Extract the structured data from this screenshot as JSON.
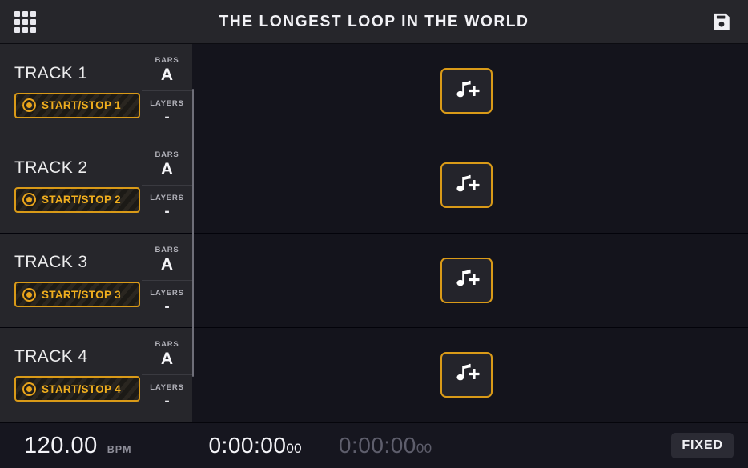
{
  "header": {
    "menu_icon": "grid-apps-icon",
    "title": "THE LONGEST LOOP IN THE WORLD",
    "save_icon": "floppy-save-icon"
  },
  "tracks": [
    {
      "name": "TRACK 1",
      "start_stop_label": "START/STOP 1",
      "record_icon": "record-target-icon",
      "bars_label": "BARS",
      "bars_value": "A",
      "layers_label": "LAYERS",
      "layers_value": "-",
      "add_clip_icon": "music-note-plus-icon"
    },
    {
      "name": "TRACK 2",
      "start_stop_label": "START/STOP 2",
      "record_icon": "record-target-icon",
      "bars_label": "BARS",
      "bars_value": "A",
      "layers_label": "LAYERS",
      "layers_value": "-",
      "add_clip_icon": "music-note-plus-icon"
    },
    {
      "name": "TRACK 3",
      "start_stop_label": "START/STOP 3",
      "record_icon": "record-target-icon",
      "bars_label": "BARS",
      "bars_value": "A",
      "layers_label": "LAYERS",
      "layers_value": "-",
      "add_clip_icon": "music-note-plus-icon"
    },
    {
      "name": "TRACK 4",
      "start_stop_label": "START/STOP 4",
      "record_icon": "record-target-icon",
      "bars_label": "BARS",
      "bars_value": "A",
      "layers_label": "LAYERS",
      "layers_value": "-",
      "add_clip_icon": "music-note-plus-icon"
    }
  ],
  "footer": {
    "bpm_value": "120.00",
    "bpm_unit": "BPM",
    "timer_primary_main": "0:00:00",
    "timer_primary_sub": "00",
    "timer_secondary_main": "0:00:00",
    "timer_secondary_sub": "00",
    "fixed_label": "FIXED"
  },
  "colors": {
    "accent_orange": "#d99a18",
    "accent_orange_text": "#f0ae1e",
    "header_bg": "#26262b",
    "canvas_bg": "#14141c",
    "panel_bg": "#26262b",
    "footer_bg": "#16161f",
    "text_primary": "#f2f2f6",
    "text_muted": "#8e8e99",
    "timer_dim": "#5e5e6c"
  }
}
